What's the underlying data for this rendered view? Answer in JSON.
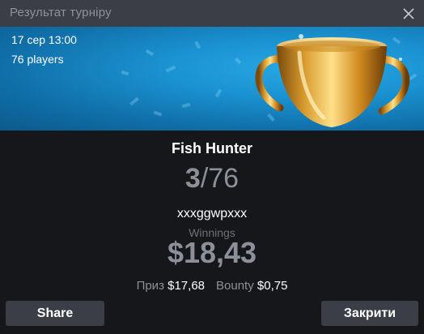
{
  "window": {
    "title": "Результат турніру",
    "close_icon": "close-icon"
  },
  "banner": {
    "date": "17 сер 13:00",
    "players": "76 players",
    "background_color": "#1a90cf",
    "trophy_icon": "trophy-icon"
  },
  "result": {
    "tournament_name": "Fish Hunter",
    "place": "3",
    "separator": "/",
    "total_players": "76",
    "player_name": "xxxggwpxxx",
    "winnings_label": "Winnings",
    "winnings_amount": "$18,43",
    "prize_label": "Приз",
    "prize_value": "$17,68",
    "bounty_label": "Bounty",
    "bounty_value": "$0,75"
  },
  "buttons": {
    "share_label": "Share",
    "close_label": "Закрити"
  },
  "colors": {
    "background": "#16171b",
    "titlebar": "#3b3e47",
    "button": "#3b3e47",
    "muted_text": "#8c9099",
    "text": "#ffffff"
  }
}
